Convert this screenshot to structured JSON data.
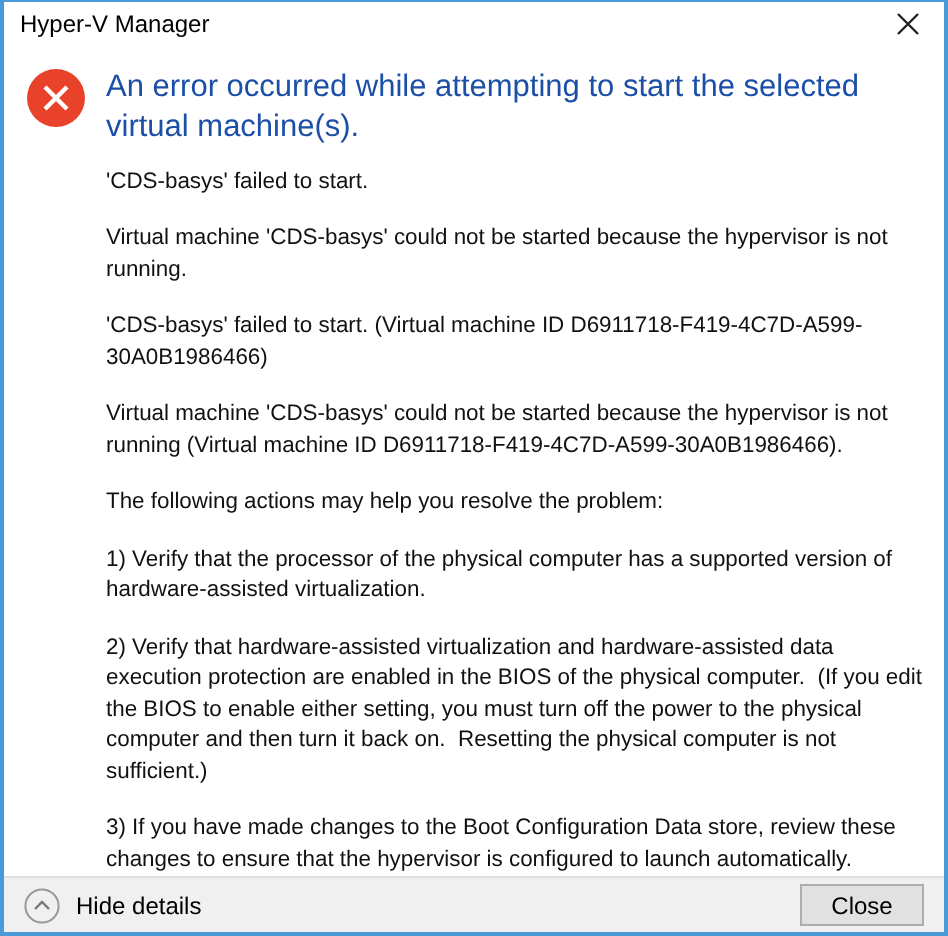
{
  "window": {
    "title": "Hyper-V Manager"
  },
  "heading": "An error occurred while attempting to start the selected virtual machine(s).",
  "paragraphs": [
    "'CDS-basys' failed to start.",
    "Virtual machine 'CDS-basys' could not be started because the hypervisor is not running.",
    "'CDS-basys' failed to start. (Virtual machine ID D6911718-F419-4C7D-A599-30A0B1986466)",
    "Virtual machine 'CDS-basys' could not be started because the hypervisor is not running (Virtual machine ID D6911718-F419-4C7D-A599-30A0B1986466).",
    "The following actions may help you resolve the problem:",
    "1) Verify that the processor of the physical computer has a supported version of hardware-assisted virtualization.",
    "2) Verify that hardware-assisted virtualization and hardware-assisted data execution protection are enabled in the BIOS of the physical computer.  (If you edit the BIOS to enable either setting, you must turn off the power to the physical computer and then turn it back on.  Resetting the physical computer is not sufficient.)",
    "3) If you have made changes to the Boot Configuration Data store, review these changes to ensure that the hypervisor is configured to launch automatically."
  ],
  "footer": {
    "details_toggle": {
      "label": "Hide details",
      "expanded": true
    },
    "close_button": "Close"
  }
}
